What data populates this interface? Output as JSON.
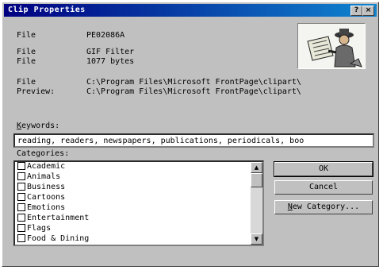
{
  "window": {
    "title": "Clip Properties",
    "help_glyph": "?",
    "close_glyph": "×"
  },
  "info": [
    {
      "label": "File",
      "value": "PE02086A"
    },
    {
      "label": "File",
      "value": "GIF Filter"
    },
    {
      "label": "File",
      "value": "1077 bytes"
    },
    {
      "label": "File",
      "value": "C:\\Program Files\\Microsoft FrontPage\\clipart\\"
    },
    {
      "label": "Preview:",
      "value": "C:\\Program Files\\Microsoft FrontPage\\clipart\\"
    }
  ],
  "keywords": {
    "label_first": "K",
    "label_rest": "eywords:",
    "value": "reading, readers, newspapers, publications, periodicals, boo"
  },
  "categories": {
    "label": "Categories:",
    "items": [
      "Academic",
      "Animals",
      "Business",
      "Cartoons",
      "Emotions",
      "Entertainment",
      "Flags",
      "Food & Dining"
    ],
    "scroll_up": "▲",
    "scroll_down": "▼"
  },
  "buttons": {
    "ok": "OK",
    "cancel": "Cancel",
    "new_category_first": "N",
    "new_category_rest": "ew Category..."
  },
  "colors": {
    "title_bar": "#000080",
    "dialog_face": "#c0c0c0"
  }
}
